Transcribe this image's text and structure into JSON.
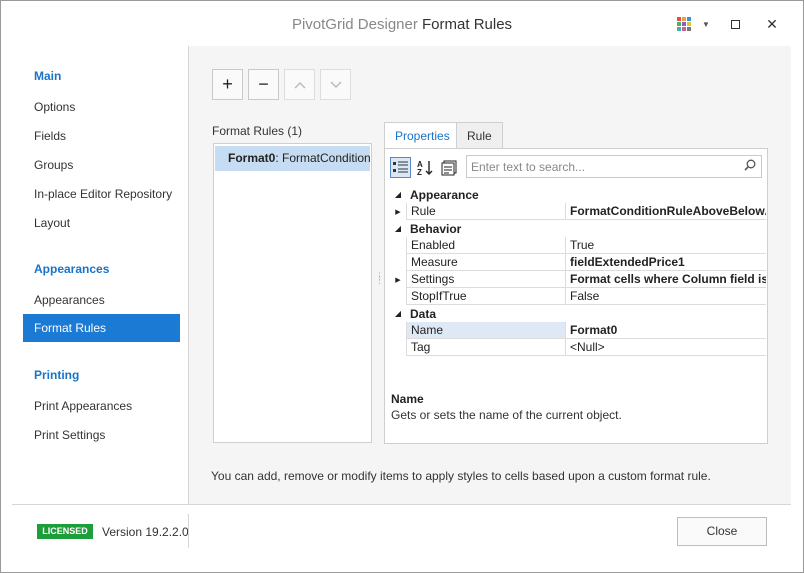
{
  "window": {
    "title_prefix": "PivotGrid Designer",
    "title_main": "Format Rules"
  },
  "sidebar": {
    "groups": [
      {
        "label": "Main",
        "items": [
          "Options",
          "Fields",
          "Groups",
          "In-place Editor Repository",
          "Layout"
        ]
      },
      {
        "label": "Appearances",
        "items": [
          "Appearances",
          "Format Rules"
        ]
      },
      {
        "label": "Printing",
        "items": [
          "Print Appearances",
          "Print Settings"
        ]
      }
    ],
    "selected": "Format Rules"
  },
  "toolbar": {
    "add_label": "+",
    "remove_label": "−",
    "up_label": "⌃",
    "down_label": "⌄"
  },
  "rules_list": {
    "label": "Format Rules (1)",
    "items": [
      {
        "name": "Format0",
        "type": ": FormatCondition"
      }
    ]
  },
  "tabs": {
    "properties": "Properties",
    "rule": "Rule"
  },
  "search": {
    "placeholder": "Enter text to search..."
  },
  "property_grid": {
    "categories": [
      {
        "name": "Appearance",
        "rows": [
          {
            "name": "Rule",
            "value": "FormatConditionRuleAboveBelowAverage",
            "bold": true,
            "expandable": true
          }
        ]
      },
      {
        "name": "Behavior",
        "rows": [
          {
            "name": "Enabled",
            "value": "True",
            "bold": false,
            "expandable": false
          },
          {
            "name": "Measure",
            "value": "fieldExtendedPrice1",
            "bold": true,
            "expandable": false
          },
          {
            "name": "Settings",
            "value": "Format cells where Column field is",
            "bold": true,
            "expandable": true
          },
          {
            "name": "StopIfTrue",
            "value": "False",
            "bold": false,
            "expandable": false
          }
        ]
      },
      {
        "name": "Data",
        "rows": [
          {
            "name": "Name",
            "value": "Format0",
            "bold": true,
            "expandable": false
          },
          {
            "name": "Tag",
            "value": "<Null>",
            "bold": false,
            "expandable": false
          }
        ]
      }
    ],
    "description": {
      "title": "Name",
      "text": "Gets or sets the name of the current object."
    }
  },
  "hint": "You can add, remove or modify items to apply styles to cells based upon a custom format rule.",
  "footer": {
    "license_badge": "LICENSED",
    "version": "Version 19.2.2.0",
    "close_label": "Close"
  },
  "colors": {
    "accent": "#1a7ad4",
    "badge_green": "#1e9e3a",
    "selected_list": "#c5dcf2"
  }
}
